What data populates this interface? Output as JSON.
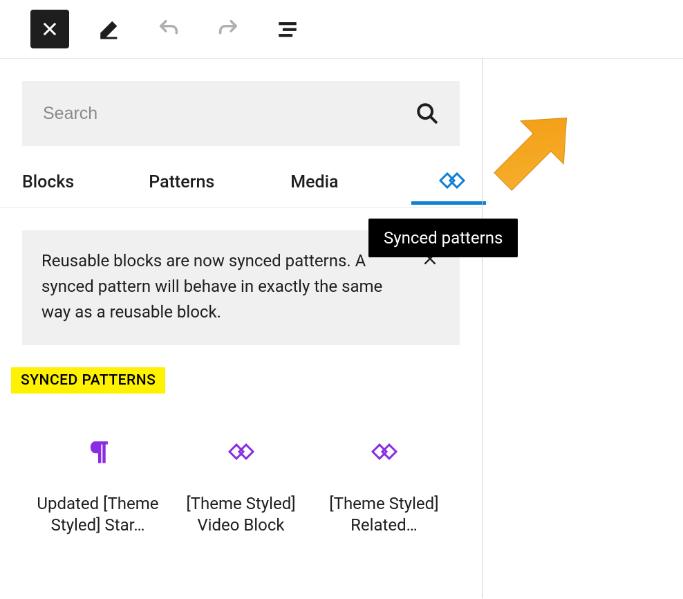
{
  "toolbar": {
    "close": "Close",
    "edit": "Edit",
    "undo": "Undo",
    "redo": "Redo",
    "outline": "Document outline"
  },
  "search": {
    "placeholder": "Search"
  },
  "tabs": {
    "blocks": "Blocks",
    "patterns": "Patterns",
    "media": "Media",
    "reusable_tooltip": "Synced patterns"
  },
  "notice": {
    "text": "Reusable blocks are now synced patterns. A synced pattern will behave in exactly the same way as a reusable block."
  },
  "section": {
    "heading": "SYNCED PATTERNS"
  },
  "patterns": [
    {
      "label": "Updated [Theme Styled] Star…",
      "icon": "pilcrow"
    },
    {
      "label": "[Theme Styled] Video Block",
      "icon": "reusable"
    },
    {
      "label": "[Theme Styled] Related…",
      "icon": "reusable"
    }
  ],
  "colors": {
    "accent": "#1080d4",
    "purple": "#8a2ce2",
    "highlight": "#fff200",
    "arrow": "#f5a623"
  }
}
